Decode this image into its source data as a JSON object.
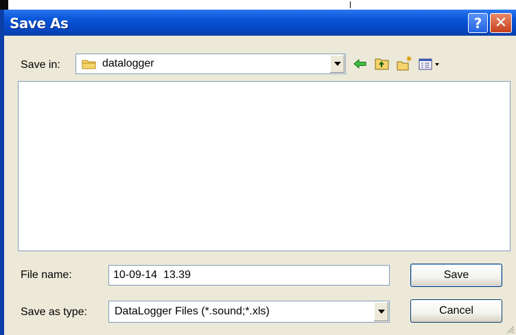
{
  "window": {
    "title": "Save As",
    "help_glyph": "?",
    "close_glyph": "✕"
  },
  "savein": {
    "label": "Save in:",
    "value": "datalogger",
    "icon": "folder-icon"
  },
  "toolbar": {
    "icons": [
      "back-arrow-icon",
      "up-folder-icon",
      "new-folder-icon",
      "view-menu-icon"
    ]
  },
  "filename": {
    "label": "File name:",
    "value": "10-09-14  13.39"
  },
  "savetype": {
    "label": "Save as type:",
    "value": "DataLogger Files (*.sound;*.xls)"
  },
  "buttons": {
    "save": "Save",
    "cancel": "Cancel"
  },
  "colors": {
    "title_bar": "#0a56d8",
    "dialog_bg": "#ece9d8",
    "border": "#7f9db9",
    "close_red": "#c6401c"
  }
}
